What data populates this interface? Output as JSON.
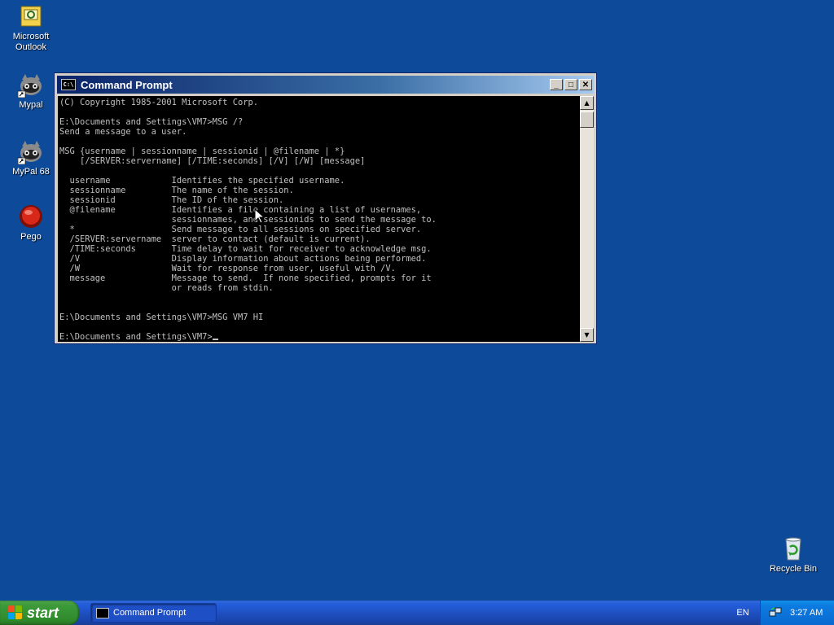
{
  "desktop": {
    "icons": [
      {
        "label_line1": "Microsoft",
        "label_line2": "Outlook"
      },
      {
        "label_line1": "Mypal",
        "label_line2": ""
      },
      {
        "label_line1": "MyPal 68",
        "label_line2": ""
      },
      {
        "label_line1": "Pego",
        "label_line2": ""
      },
      {
        "label_line1": "Recycle Bin",
        "label_line2": ""
      }
    ]
  },
  "window": {
    "title": "Command Prompt",
    "icon_text": "C:\\",
    "minimize_glyph": "_",
    "maximize_glyph": "□",
    "close_glyph": "✕",
    "lines": [
      "(C) Copyright 1985-2001 Microsoft Corp.",
      "",
      "E:\\Documents and Settings\\VM7>MSG /?",
      "Send a message to a user.",
      "",
      "MSG {username | sessionname | sessionid | @filename | *}",
      "    [/SERVER:servername] [/TIME:seconds] [/V] [/W] [message]",
      "",
      "  username            Identifies the specified username.",
      "  sessionname         The name of the session.",
      "  sessionid           The ID of the session.",
      "  @filename           Identifies a file containing a list of usernames,",
      "                      sessionnames, and sessionids to send the message to.",
      "  *                   Send message to all sessions on specified server.",
      "  /SERVER:servername  server to contact (default is current).",
      "  /TIME:seconds       Time delay to wait for receiver to acknowledge msg.",
      "  /V                  Display information about actions being performed.",
      "  /W                  Wait for response from user, useful with /V.",
      "  message             Message to send.  If none specified, prompts for it",
      "                      or reads from stdin.",
      "",
      "",
      "E:\\Documents and Settings\\VM7>MSG VM7 HI",
      "",
      "E:\\Documents and Settings\\VM7>"
    ],
    "scroll_up_glyph": "▲",
    "scroll_down_glyph": "▼"
  },
  "taskbar": {
    "start_label": "start",
    "task_label": "Command Prompt",
    "language": "EN",
    "clock": "3:27 AM"
  },
  "colors": {
    "desktop": "#0d4a9a",
    "titlebar": "#0a246a",
    "console_bg": "#000000",
    "console_fg": "#c0c0c0"
  }
}
